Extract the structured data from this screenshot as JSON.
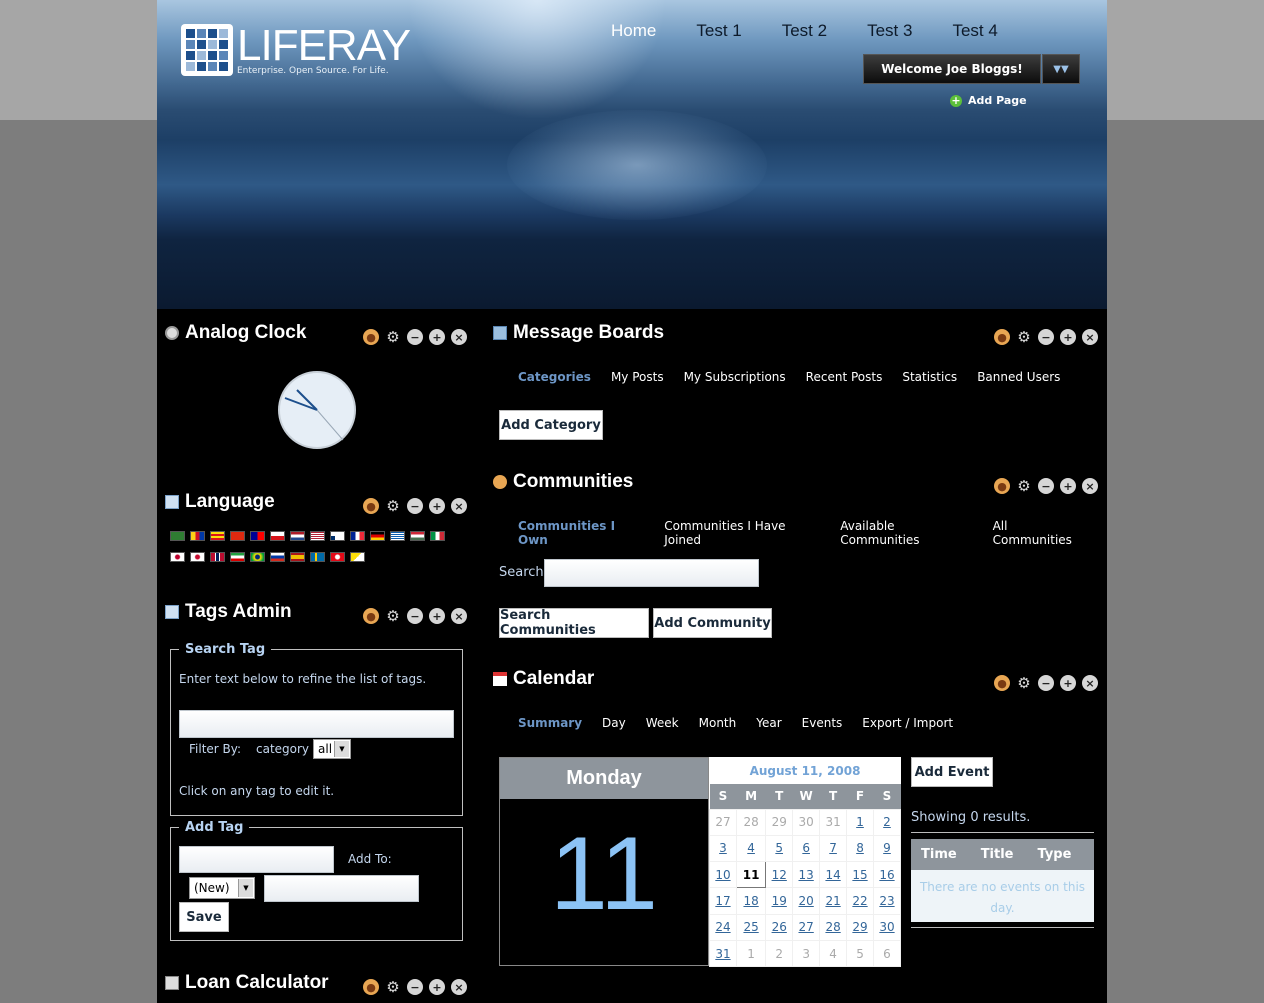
{
  "brand": {
    "name": "LIFERAY",
    "tagline": "Enterprise. Open Source. For Life."
  },
  "nav": {
    "items": [
      {
        "label": "Home",
        "active": true
      },
      {
        "label": "Test 1",
        "active": false
      },
      {
        "label": "Test 2",
        "active": false
      },
      {
        "label": "Test 3",
        "active": false
      },
      {
        "label": "Test 4",
        "active": false
      }
    ]
  },
  "user": {
    "welcome": "Welcome Joe Bloggs!",
    "add_page": "Add Page"
  },
  "portlets": {
    "analog_clock": {
      "title": "Analog Clock"
    },
    "language": {
      "title": "Language"
    },
    "tags_admin": {
      "title": "Tags Admin",
      "search_legend": "Search Tag",
      "search_hint": "Enter text below to refine the list of tags.",
      "filter_label": "Filter By:",
      "filter_field": "category",
      "filter_value": "all",
      "click_hint": "Click on any tag to edit it.",
      "add_legend": "Add Tag",
      "add_to_label": "Add To:",
      "add_select_value": "(New)",
      "save_button": "Save"
    },
    "loan_calculator": {
      "title": "Loan Calculator"
    },
    "message_boards": {
      "title": "Message Boards",
      "tabs": [
        "Categories",
        "My Posts",
        "My Subscriptions",
        "Recent Posts",
        "Statistics",
        "Banned Users"
      ],
      "add_button": "Add Category"
    },
    "communities": {
      "title": "Communities",
      "tabs": [
        "Communities I Own",
        "Communities I Have Joined",
        "Available Communities",
        "All Communities"
      ],
      "search_label": "Search",
      "search_button": "Search Communities",
      "add_button": "Add Community"
    },
    "calendar": {
      "title": "Calendar",
      "tabs": [
        "Summary",
        "Day",
        "Week",
        "Month",
        "Year",
        "Events",
        "Export / Import"
      ],
      "day_name": "Monday",
      "day_number": "11",
      "month_title": "August 11, 2008",
      "weekdays": [
        "S",
        "M",
        "T",
        "W",
        "T",
        "F",
        "S"
      ],
      "weeks": [
        [
          "27",
          "28",
          "29",
          "30",
          "31",
          "1",
          "2"
        ],
        [
          "3",
          "4",
          "5",
          "6",
          "7",
          "8",
          "9"
        ],
        [
          "10",
          "11",
          "12",
          "13",
          "14",
          "15",
          "16"
        ],
        [
          "17",
          "18",
          "19",
          "20",
          "21",
          "22",
          "23"
        ],
        [
          "24",
          "25",
          "26",
          "27",
          "28",
          "29",
          "30"
        ],
        [
          "31",
          "1",
          "2",
          "3",
          "4",
          "5",
          "6"
        ]
      ],
      "add_event_button": "Add Event",
      "results_text": "Showing 0 results.",
      "columns": [
        "Time",
        "Title",
        "Type"
      ],
      "empty_text": "There are no events on this day."
    }
  },
  "colors": {
    "accent_link": "#6d96c6",
    "header_gray": "#8e959c",
    "day_number": "#8cc3f5"
  }
}
